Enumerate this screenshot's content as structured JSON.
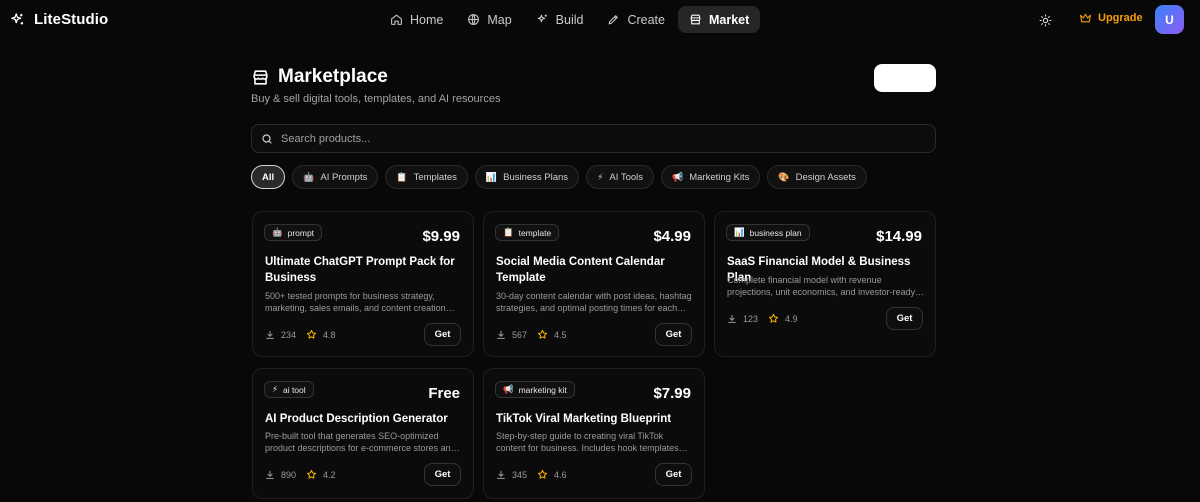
{
  "app": {
    "name": "LiteStudio"
  },
  "nav": [
    {
      "label": "Home",
      "icon": "home-icon"
    },
    {
      "label": "Map",
      "icon": "globe-icon"
    },
    {
      "label": "Build",
      "icon": "sparkles-icon"
    },
    {
      "label": "Create",
      "icon": "pen-icon"
    },
    {
      "label": "Market",
      "icon": "store-icon",
      "active": true
    }
  ],
  "header": {
    "upgrade_label": "Upgrade",
    "avatar_initial": "U"
  },
  "page": {
    "title": "Marketplace",
    "subtitle": "Buy & sell digital tools, templates, and AI resources"
  },
  "search": {
    "placeholder": "Search products..."
  },
  "filters": [
    {
      "emoji": "",
      "label": "All",
      "active": true
    },
    {
      "emoji": "🤖",
      "label": "AI Prompts"
    },
    {
      "emoji": "📋",
      "label": "Templates"
    },
    {
      "emoji": "📊",
      "label": "Business Plans"
    },
    {
      "emoji": "⚡",
      "label": "AI Tools"
    },
    {
      "emoji": "📢",
      "label": "Marketing Kits"
    },
    {
      "emoji": "🎨",
      "label": "Design Assets"
    }
  ],
  "products": [
    {
      "badge_emoji": "🤖",
      "badge": "prompt",
      "price": "$9.99",
      "title": "Ultimate ChatGPT Prompt Pack for Business",
      "description": "500+ tested prompts for business strategy, marketing, sales emails, and content creation and more.",
      "downloads": "234",
      "rating": "4.8",
      "cta": "Get"
    },
    {
      "badge_emoji": "📋",
      "badge": "template",
      "price": "$4.99",
      "title": "Social Media Content Calendar Template",
      "description": "30-day content calendar with post ideas, hashtag strategies, and optimal posting times for each platform.",
      "downloads": "567",
      "rating": "4.5",
      "cta": "Get"
    },
    {
      "badge_emoji": "📊",
      "badge": "business plan",
      "price": "$14.99",
      "title": "SaaS Financial Model & Business Plan",
      "description": "Complete financial model with revenue projections, unit economics, and investor-ready templates.",
      "downloads": "123",
      "rating": "4.9",
      "cta": "Get"
    },
    {
      "badge_emoji": "⚡",
      "badge": "ai tool",
      "price": "Free",
      "title": "AI Product Description Generator",
      "description": "Pre-built tool that generates SEO-optimized product descriptions for e-commerce stores and listings.",
      "downloads": "890",
      "rating": "4.2",
      "cta": "Get"
    },
    {
      "badge_emoji": "📢",
      "badge": "marketing kit",
      "price": "$7.99",
      "title": "TikTok Viral Marketing Blueprint",
      "description": "Step-by-step guide to creating viral TikTok content for business. Includes hook templates and scripts.",
      "downloads": "345",
      "rating": "4.6",
      "cta": "Get"
    }
  ],
  "colors": {
    "background": "#080808",
    "accent_upgrade": "#f59e0b",
    "star": "#f5b400",
    "avatar_from": "#3b82f6",
    "avatar_to": "#8b5cf6"
  }
}
